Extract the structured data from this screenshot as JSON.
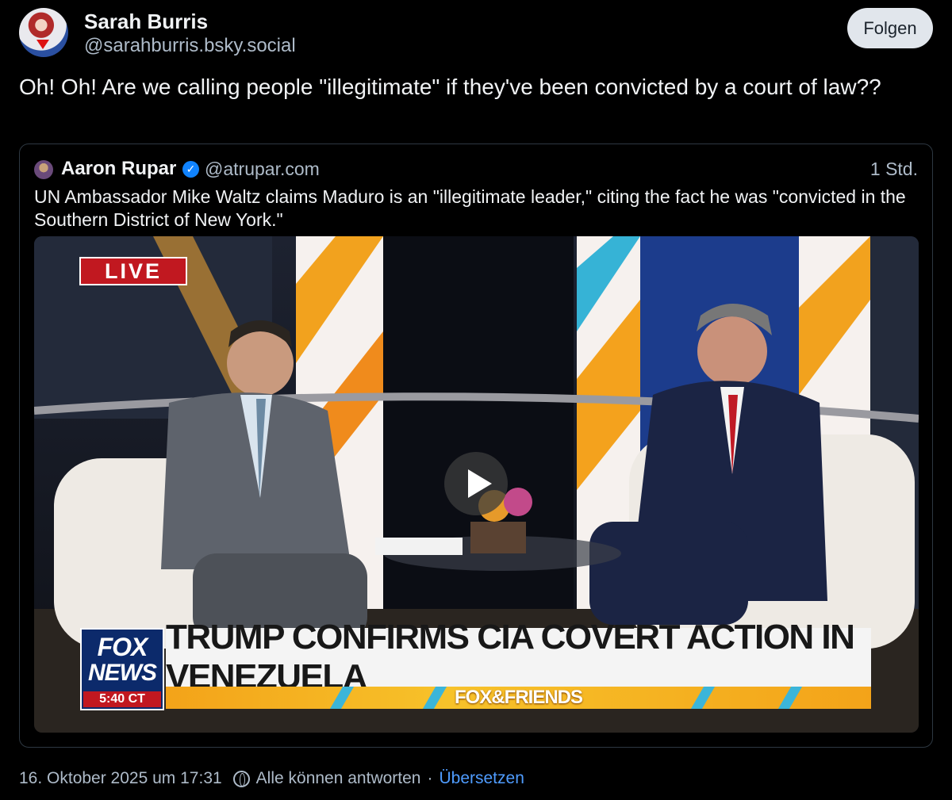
{
  "post": {
    "author_name": "Sarah Burris",
    "author_handle": "@sarahburris.bsky.social",
    "follow_label": "Folgen",
    "text": "Oh! Oh! Are we calling people \"illegitimate\" if they've been convicted by a court of law??"
  },
  "quote": {
    "author_name": "Aaron Rupar",
    "author_handle": "@atrupar.com",
    "time": "1 Std.",
    "verified_icon": "check-icon",
    "text": "UN Ambassador Mike Waltz claims Maduro is an \"illegitimate leader,\" citing the fact he was \"convicted in the Southern District of New York.\"",
    "video": {
      "live_label": "LIVE",
      "network_line1": "FOX",
      "network_line2": "NEWS",
      "clock": "5:40 CT",
      "headline": "TRUMP CONFIRMS CIA COVERT ACTION IN VENEZUELA",
      "show_name": "FOX&FRIENDS"
    }
  },
  "footer": {
    "timestamp": "16. Oktober 2025 um 17:31",
    "reply_setting": "Alle können antworten",
    "separator": "·",
    "translate_label": "Übersetzen"
  },
  "colors": {
    "background": "#000000",
    "accent": "#1083fe",
    "link": "#4f9cff",
    "fox_red": "#c11820"
  }
}
